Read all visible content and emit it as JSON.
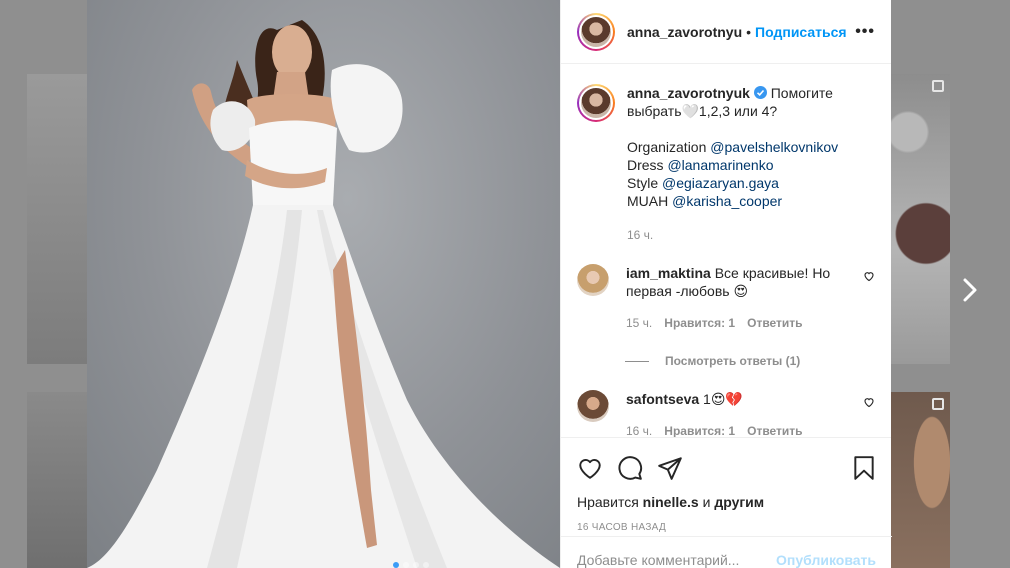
{
  "post": {
    "author": "anna_zavorotnyuk",
    "author_truncated": "anna_zavorotnyu",
    "follow_label": "Подписаться",
    "separator": "•",
    "more_label": "•••",
    "caption_text": "Помогите выбрать🤍1,2,3 или 4?",
    "credits": [
      {
        "role": "Organization",
        "handle": "@pavelshelkovnikov"
      },
      {
        "role": "Dress",
        "handle": "@lanamarinenko"
      },
      {
        "role": "Style",
        "handle": "@egiazaryan.gaya"
      },
      {
        "role": "MUAH",
        "handle": "@karisha_cooper"
      }
    ],
    "caption_time": "16 ч."
  },
  "comments": [
    {
      "username": "iam_maktina",
      "text": "Все красивые! Но первая -любовь 😍",
      "time": "15 ч.",
      "likes": "Нравится: 1",
      "reply": "Ответить",
      "replies_label": "Посмотреть ответы (1)"
    },
    {
      "username": "safontseva",
      "text": "1😍💔",
      "time": "16 ч.",
      "likes": "Нравится: 1",
      "reply": "Ответить"
    }
  ],
  "likes": {
    "prefix": "Нравится",
    "user": "ninelle.s",
    "middle": "и",
    "others": "другим"
  },
  "timestamp": "16 часов назад",
  "composer": {
    "placeholder": "Добавьте комментарий...",
    "publish_label": "Опубликовать"
  },
  "colors": {
    "accent": "#0095f6",
    "link": "#00376b",
    "muted": "#8e8e8e",
    "verified": "#3897f0"
  }
}
